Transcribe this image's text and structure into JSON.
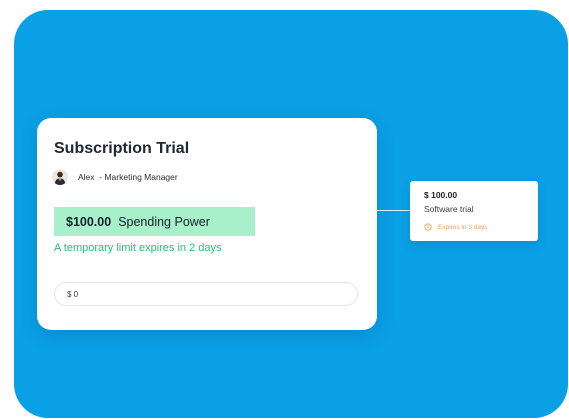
{
  "card": {
    "title": "Subscription Trial",
    "user_name": "Alex",
    "user_role": "- Marketing Manager",
    "spending_amount": "$100.00",
    "spending_label": "Spending Power",
    "limit_note": "A temporary limit expires in 2 days",
    "amount_input_value": "$ 0"
  },
  "side_card": {
    "amount": "$ 100.00",
    "label": "Software trial",
    "expiry": "Expires in 3 days"
  },
  "colors": {
    "background": "#0aa0e6",
    "pill": "#a7f0c9",
    "limit_text": "#2ebc75",
    "expiry": "#f4a259"
  },
  "icons": {
    "avatar": "avatar",
    "expiry": "clock-icon"
  }
}
